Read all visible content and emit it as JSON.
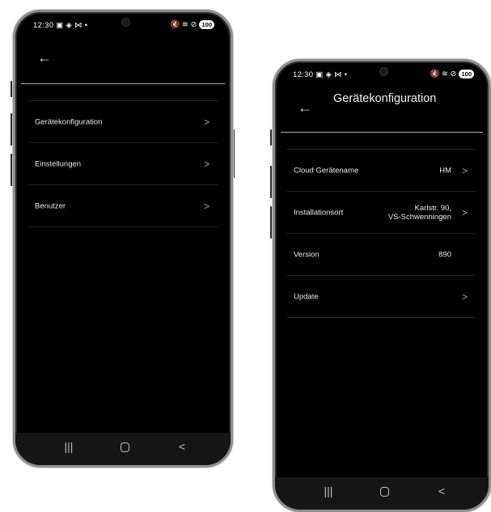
{
  "status": {
    "time": "12:30",
    "battery": "100",
    "left_icons": "▣ ◈ ⋈ •",
    "right_icons": "🔇 ≋ ⊘"
  },
  "phone1": {
    "back_icon": "←",
    "menu": [
      {
        "label": "Gerätekonfiguration",
        "chevron": ">"
      },
      {
        "label": "Einstellungen",
        "chevron": ">"
      },
      {
        "label": "Benutzer",
        "chevron": ">"
      }
    ],
    "nav": {
      "recents": "|||",
      "back": "<"
    }
  },
  "phone2": {
    "back_icon": "←",
    "title": "Gerätekonfiguration",
    "rows": [
      {
        "label": "Cloud Gerätename",
        "value": "HM",
        "chevron": ">"
      },
      {
        "label": "Installationsort",
        "value_line1": "Karlstr. 90,",
        "value_line2": "VS-Schwenningen",
        "chevron": ">"
      },
      {
        "label": "Version",
        "value": "890"
      },
      {
        "label": "Update",
        "chevron": ">"
      }
    ],
    "nav": {
      "recents": "|||",
      "back": "<"
    }
  }
}
